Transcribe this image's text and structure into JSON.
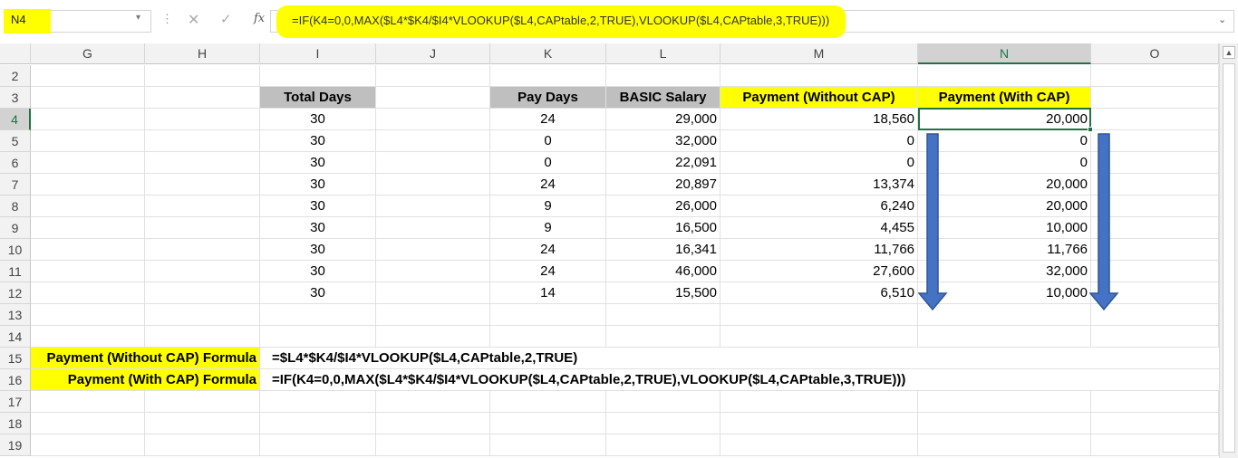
{
  "formula_bar": {
    "name_box": "N4",
    "name_box_arrow": "▾",
    "dots": "⋮",
    "cancel_icon": "✕",
    "enter_icon": "✓",
    "fx_label": "fx",
    "formula": "=IF(K4=0,0,MAX($L4*$K4/$I4*VLOOKUP($L4,CAPtable,2,TRUE),VLOOKUP($L4,CAPtable,3,TRUE)))",
    "expand": "⌄"
  },
  "columns": [
    "G",
    "H",
    "I",
    "J",
    "K",
    "L",
    "M",
    "N",
    "O"
  ],
  "selected_column": "N",
  "rows": [
    {
      "n": "2"
    },
    {
      "n": "3",
      "I": "Total Days",
      "K": "Pay Days",
      "L": "BASIC Salary",
      "M": "Payment (Without CAP)",
      "N": "Payment (With CAP)"
    },
    {
      "n": "4",
      "I": "30",
      "K": "24",
      "L": "29,000",
      "M": "18,560",
      "N": "20,000"
    },
    {
      "n": "5",
      "I": "30",
      "K": "0",
      "L": "32,000",
      "M": "0",
      "N": "0"
    },
    {
      "n": "6",
      "I": "30",
      "K": "0",
      "L": "22,091",
      "M": "0",
      "N": "0"
    },
    {
      "n": "7",
      "I": "30",
      "K": "24",
      "L": "20,897",
      "M": "13,374",
      "N": "20,000"
    },
    {
      "n": "8",
      "I": "30",
      "K": "9",
      "L": "26,000",
      "M": "6,240",
      "N": "20,000"
    },
    {
      "n": "9",
      "I": "30",
      "K": "9",
      "L": "16,500",
      "M": "4,455",
      "N": "10,000"
    },
    {
      "n": "10",
      "I": "30",
      "K": "24",
      "L": "16,341",
      "M": "11,766",
      "N": "11,766"
    },
    {
      "n": "11",
      "I": "30",
      "K": "24",
      "L": "46,000",
      "M": "27,600",
      "N": "32,000"
    },
    {
      "n": "12",
      "I": "30",
      "K": "14",
      "L": "15,500",
      "M": "6,510",
      "N": "10,000"
    },
    {
      "n": "13"
    },
    {
      "n": "14"
    },
    {
      "n": "15",
      "G": "Payment (Without CAP) Formula",
      "I": "=$L4*$K4/$I4*VLOOKUP($L4,CAPtable,2,TRUE)"
    },
    {
      "n": "16",
      "G": "Payment (With CAP) Formula",
      "I": "=IF(K4=0,0,MAX($L4*$K4/$I4*VLOOKUP($L4,CAPtable,2,TRUE),VLOOKUP($L4,CAPtable,3,TRUE)))"
    },
    {
      "n": "17"
    },
    {
      "n": "18"
    },
    {
      "n": "19"
    }
  ],
  "colors": {
    "highlight_yellow": "#ffff00",
    "header_gray": "#bfbfbf",
    "selection_green": "#217346",
    "arrow_blue": "#4472c4"
  },
  "scroll": {
    "up_arrow": "▲"
  }
}
